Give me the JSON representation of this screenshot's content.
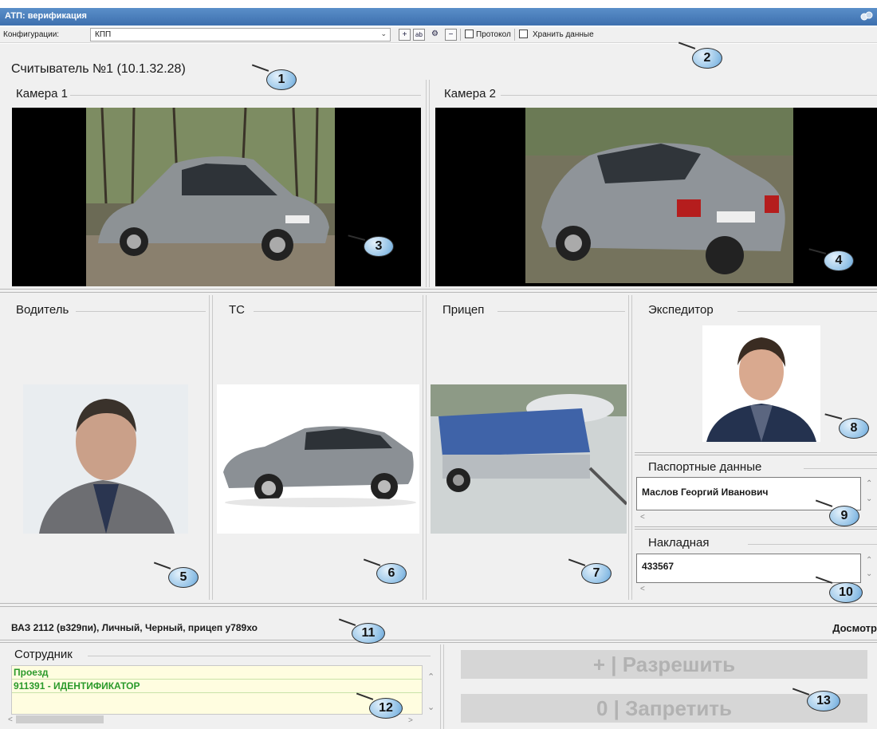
{
  "window": {
    "title": "АТП: верификация"
  },
  "toolbar": {
    "config_label": "Конфигурации:",
    "config_value": "КПП",
    "protocol_label": "Протокол",
    "store_label": "Хранить данные"
  },
  "reader": {
    "title": "Считыватель №1 (10.1.32.28)"
  },
  "cameras": {
    "camera1": "Камера 1",
    "camera2": "Камера 2"
  },
  "sections": {
    "driver": "Водитель",
    "vehicle": "ТС",
    "trailer": "Прицеп",
    "forwarder": "Экспедитор"
  },
  "passport": {
    "label": "Паспортные данные",
    "value": "Маслов Георгий Иванович"
  },
  "invoice": {
    "label": "Накладная",
    "value": "433567"
  },
  "summary": {
    "vehicle_info": "ВАЗ 2112 (в329пи), Личный, Черный, прицеп у789хо",
    "status": "Досмотр"
  },
  "staff": {
    "title": "Сотрудник",
    "rows": [
      "Проезд",
      "911391 - ИДЕНТИФИКАТОР"
    ]
  },
  "actions": {
    "allow": "+ | Разрешить",
    "deny": "0 | Запретить"
  },
  "callouts": [
    "1",
    "2",
    "3",
    "4",
    "5",
    "6",
    "7",
    "8",
    "9",
    "10",
    "11",
    "12",
    "13"
  ],
  "colors": {
    "titlebar": "#3d6fae",
    "callout": "#8fc0e6",
    "staff_text": "#2a9a2a"
  }
}
